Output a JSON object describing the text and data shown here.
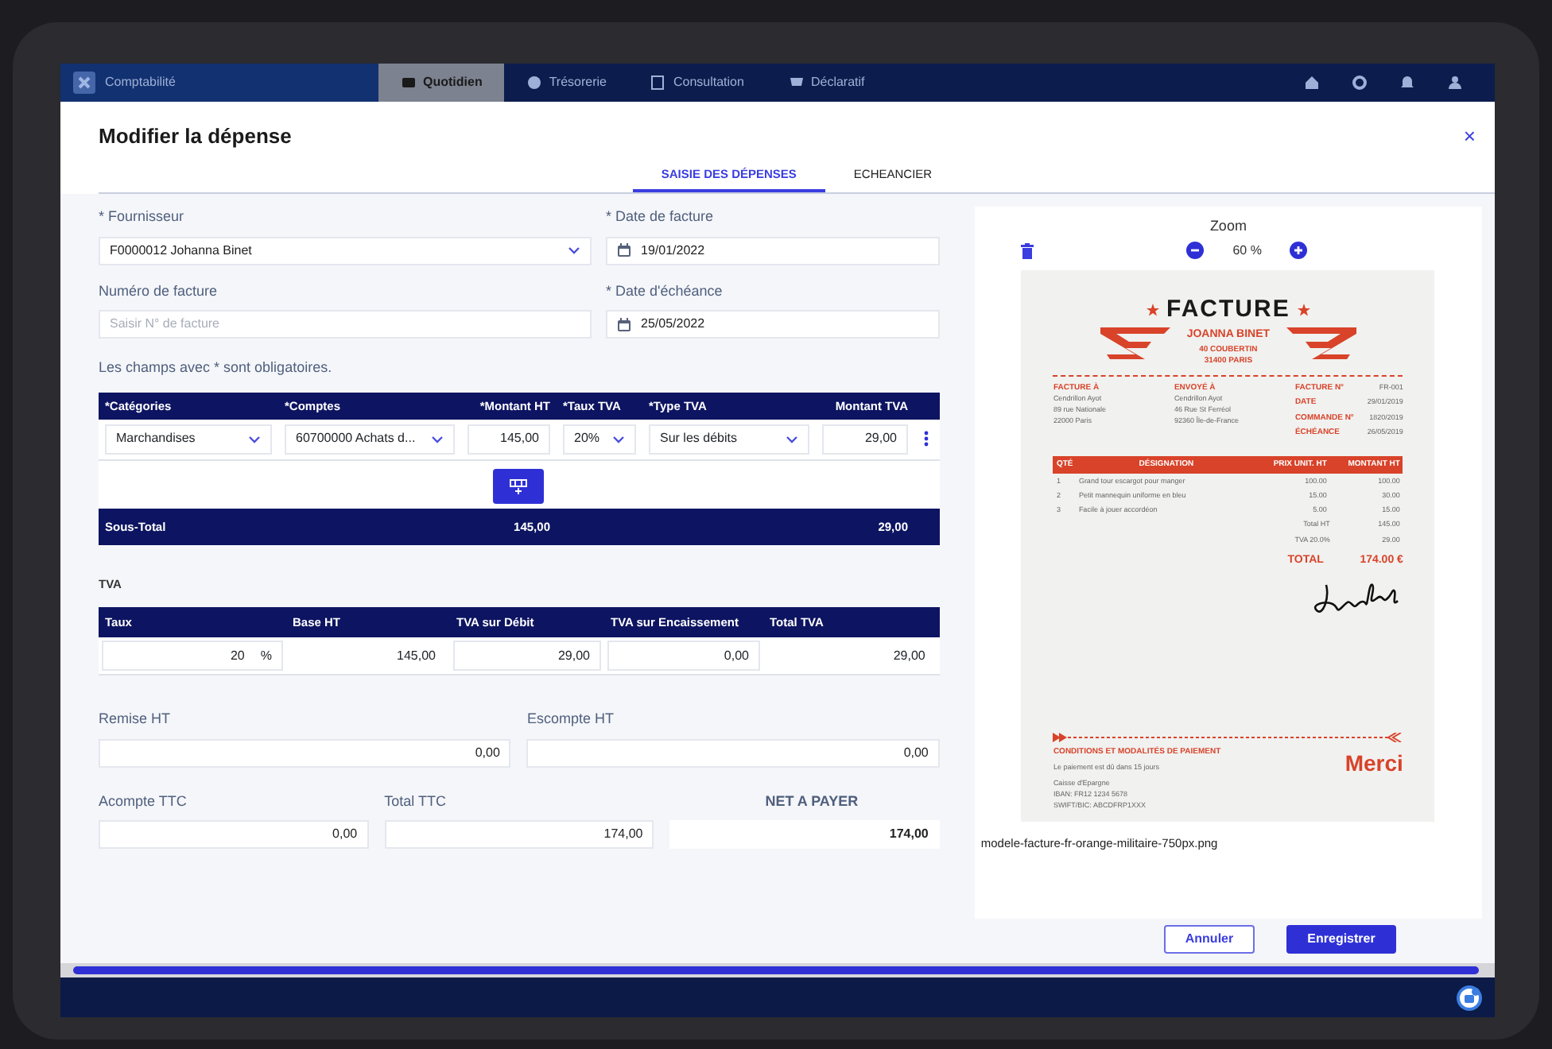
{
  "app_bar": {
    "title": "Comptabilité",
    "items": [
      {
        "label": "Quotidien",
        "selected": true
      },
      {
        "label": "Trésorerie",
        "selected": false
      },
      {
        "label": "Consultation",
        "selected": false
      },
      {
        "label": "Déclaratif",
        "selected": false
      }
    ]
  },
  "dialog": {
    "title": "Modifier la dépense",
    "close": "×"
  },
  "tabs": [
    {
      "label": "SAISIE DES DÉPENSES",
      "selected": true
    },
    {
      "label": "ECHEANCIER",
      "selected": false
    }
  ],
  "fields": [
    {
      "label": "* Fournisseur",
      "kind": "select",
      "value": "F0000012 Johanna Binet"
    },
    {
      "label": "* Date de facture",
      "kind": "date",
      "value": "19/01/2022"
    },
    {
      "label": "Numéro de facture",
      "kind": "text",
      "placeholder": "Saisir N° de facture"
    },
    {
      "label": "* Date d'échéance",
      "kind": "date",
      "value": "25/05/2022"
    }
  ],
  "note": "Les champs avec * sont obligatoires.",
  "lines": {
    "columns": [
      "*Catégories",
      "*Comptes",
      "*Montant HT",
      "*Taux TVA",
      "*Type TVA",
      "Montant TVA"
    ],
    "rows": [
      {
        "cells": [
          {
            "kind": "select",
            "value": "Marchandises"
          },
          {
            "kind": "select",
            "value": "60700000 Achats d..."
          },
          {
            "kind": "number",
            "value": "145,00"
          },
          {
            "kind": "select",
            "value": "20%"
          },
          {
            "kind": "select",
            "value": "Sur les débits"
          },
          {
            "kind": "number",
            "value": "29,00"
          }
        ]
      }
    ],
    "subtotal": {
      "label": "Sous-Total",
      "amount_ht": "145,00",
      "amount_tva": "29,00"
    }
  },
  "tva": {
    "title": "TVA",
    "columns": [
      "Taux",
      "Base HT",
      "TVA sur Débit",
      "TVA sur Encaissement",
      "Total TVA"
    ],
    "row": [
      {
        "kind": "input",
        "value": "20",
        "unit": "%"
      },
      {
        "kind": "plain",
        "value": "145,00"
      },
      {
        "kind": "input",
        "value": "29,00"
      },
      {
        "kind": "input",
        "value": "0,00"
      },
      {
        "kind": "plain",
        "value": "29,00"
      }
    ]
  },
  "amounts": [
    [
      {
        "label": "Remise HT",
        "value": "0,00",
        "bold": false
      },
      {
        "label": "Escompte HT",
        "value": "0,00",
        "bold": false
      }
    ],
    [
      {
        "label": "Acompte TTC",
        "value": "0,00",
        "bold": false
      },
      {
        "label": "Total TTC",
        "value": "174,00",
        "bold": false
      },
      {
        "label": "NET A PAYER",
        "value": "174,00",
        "bold": true
      }
    ]
  ],
  "preview": {
    "zoom_label": "Zoom",
    "zoom_value": "60 %",
    "filename": "modele-facture-fr-orange-militaire-750px.png",
    "invoice": {
      "title": "FACTURE",
      "issuer": [
        "JOANNA BINET",
        "40 COUBERTIN",
        "31400 PARIS"
      ],
      "parties": [
        {
          "heading": "FACTURE À",
          "lines": [
            "Cendrillon Ayot",
            "89 rue Nationale",
            "22000 Paris"
          ]
        },
        {
          "heading": "ENVOYÉ À",
          "lines": [
            "Cendrillon Ayot",
            "46 Rue St Ferréol",
            "92360 Île-de-France"
          ]
        }
      ],
      "meta": [
        {
          "label": "FACTURE N°",
          "value": "FR-001"
        },
        {
          "label": "DATE",
          "value": "29/01/2019"
        },
        {
          "label": "COMMANDE N°",
          "value": "1820/2019"
        },
        {
          "label": "ÉCHÉANCE",
          "value": "26/05/2019"
        }
      ],
      "columns": [
        "QTÉ",
        "DÉSIGNATION",
        "PRIX UNIT. HT",
        "MONTANT HT"
      ],
      "rows": [
        [
          "1",
          "Grand tour escargot pour manger",
          "100.00",
          "100.00"
        ],
        [
          "2",
          "Petit mannequin uniforme en bleu",
          "15.00",
          "30.00"
        ],
        [
          "3",
          "Facile à jouer accordéon",
          "5.00",
          "15.00"
        ]
      ],
      "subtotals": [
        {
          "label": "Total HT",
          "value": "145.00"
        },
        {
          "label": "TVA 20.0%",
          "value": "29.00"
        }
      ],
      "total": {
        "label": "TOTAL",
        "value": "174.00 €"
      },
      "conditions_title": "CONDITIONS ET MODALITÉS DE PAIEMENT",
      "conditions": "Le paiement est dû dans 15 jours",
      "bank": [
        "Caisse d'Epargne",
        "IBAN: FR12 1234 5678",
        "SWIFT/BIC: ABCDFRP1XXX"
      ],
      "thanks": "Merci"
    }
  },
  "buttons": [
    {
      "label": "Annuler",
      "kind": "outline"
    },
    {
      "label": "Enregistrer",
      "kind": "primary"
    }
  ]
}
